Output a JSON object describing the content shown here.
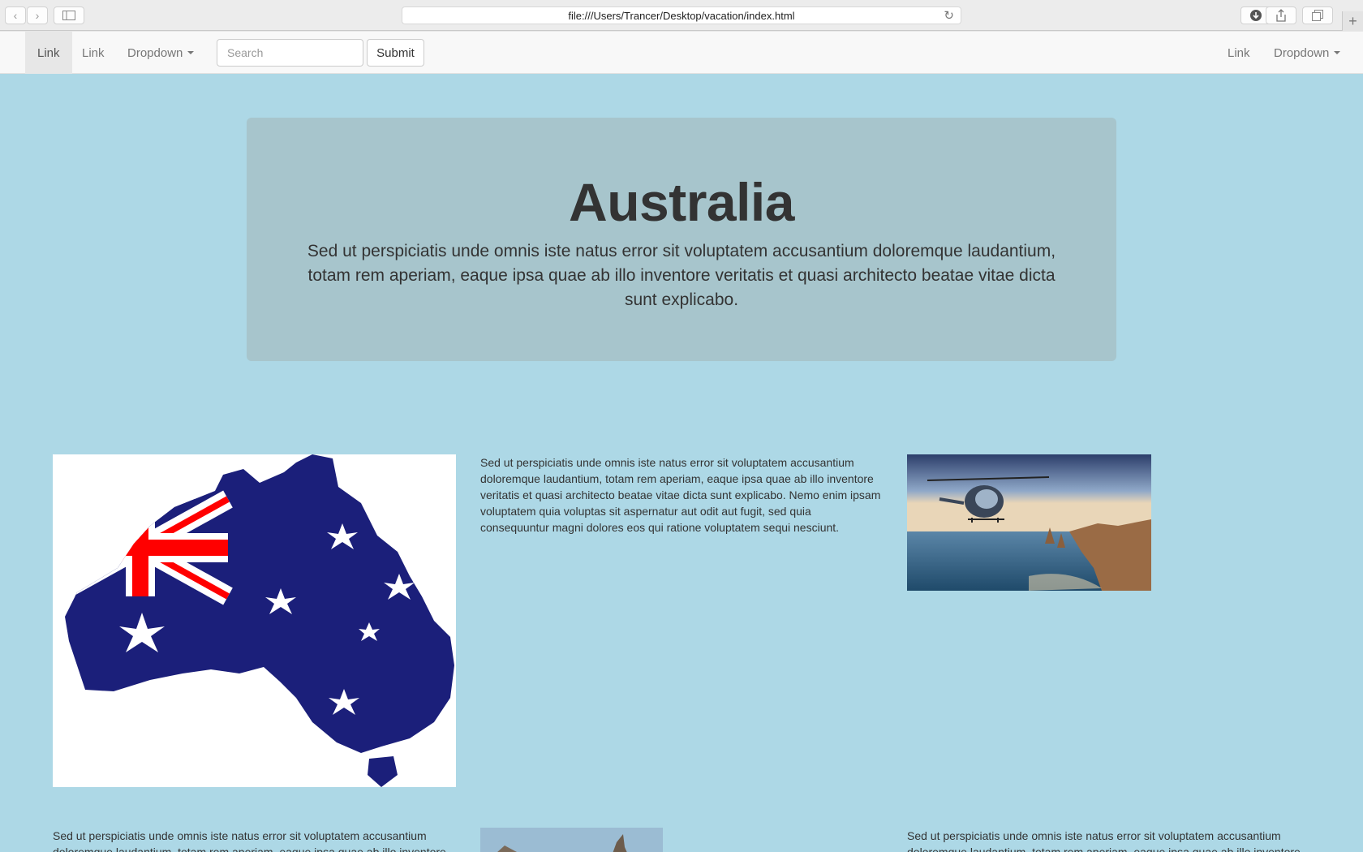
{
  "browser": {
    "url": "file:///Users/Trancer/Desktop/vacation/index.html",
    "back_icon": "chevron-left-icon",
    "forward_icon": "chevron-right-icon"
  },
  "navbar": {
    "left_items": [
      "Link",
      "Link"
    ],
    "dropdown_label": "Dropdown",
    "search_placeholder": "Search",
    "submit_label": "Submit",
    "right_link": "Link",
    "right_dropdown_label": "Dropdown"
  },
  "jumbotron": {
    "title": "Australia",
    "text": "Sed ut perspiciatis unde omnis iste natus error sit voluptatem accusantium doloremque laudantium, totam rem aperiam, eaque ipsa quae ab illo inventore veritatis et quasi architecto beatae vitae dicta sunt explicabo."
  },
  "content": {
    "paragraph_1": "Sed ut perspiciatis unde omnis iste natus error sit voluptatem accusantium doloremque laudantium, totam rem aperiam, eaque ipsa quae ab illo inventore veritatis et quasi architecto beatae vitae dicta sunt explicabo. Nemo enim ipsam voluptatem quia voluptas sit aspernatur aut odit aut fugit, sed quia consequuntur magni dolores eos qui ratione voluptatem sequi nesciunt.",
    "paragraph_2": "Sed ut perspiciatis unde omnis iste natus error sit voluptatem accusantium doloremque laudantium, totam rem aperiam, eaque ipsa quae ab illo inventore",
    "paragraph_3": "Sed ut perspiciatis unde omnis iste natus error sit voluptatem accusantium doloremque laudantium, totam rem aperiam, eaque ipsa quae ab illo inventore"
  },
  "colors": {
    "page_bg": "#add8e6",
    "jumbotron_bg": "#a7c5cc",
    "flag_blue": "#1b1f7a",
    "flag_red": "#ff0000"
  }
}
